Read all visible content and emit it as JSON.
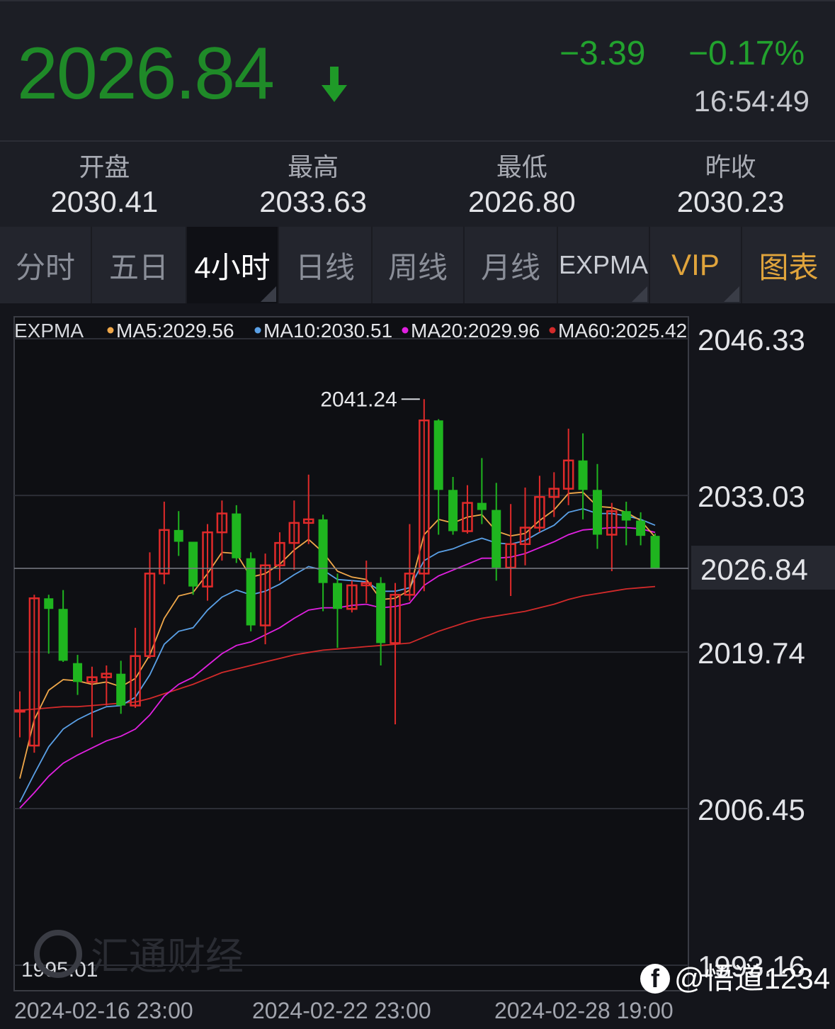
{
  "header": {
    "price": "2026.84",
    "arrow_icon": "arrow-down-icon",
    "change": "−3.39",
    "change_pct": "−0.17%",
    "time": "16:54:49"
  },
  "stats": [
    {
      "label": "开盘",
      "value": "2030.41"
    },
    {
      "label": "最高",
      "value": "2033.63"
    },
    {
      "label": "最低",
      "value": "2026.80"
    },
    {
      "label": "昨收",
      "value": "2030.23"
    }
  ],
  "tabs": [
    {
      "label": "分时"
    },
    {
      "label": "五日"
    },
    {
      "label": "4小时",
      "active": true
    },
    {
      "label": "日线"
    },
    {
      "label": "周线"
    },
    {
      "label": "月线"
    },
    {
      "label": "EXPMA"
    },
    {
      "label": "VIP"
    },
    {
      "label": "图表"
    }
  ],
  "colors": {
    "up": "#e02a2a",
    "down": "#1fb51f",
    "ma5": "#f0a84a",
    "ma10": "#5aa0e6",
    "ma20": "#e020e0",
    "ma60": "#d22a2a",
    "price": "#1f8a28"
  },
  "chart_data": {
    "type": "candlestick",
    "indicator": "EXPMA",
    "legend": [
      {
        "name": "MA5",
        "value": "2029.56",
        "color": "#f0a84a"
      },
      {
        "name": "MA10",
        "value": "2030.51",
        "color": "#5aa0e6"
      },
      {
        "name": "MA20",
        "value": "2029.96",
        "color": "#e020e0"
      },
      {
        "name": "MA60",
        "value": "2025.42",
        "color": "#d22a2a"
      }
    ],
    "y_ticks": [
      "2046.33",
      "2033.03",
      "2019.74",
      "2006.45",
      "1993.16"
    ],
    "ylim": [
      1993.16,
      2046.33
    ],
    "current_price": "2026.84",
    "max_label": "2041.24",
    "min_label": "1995.01",
    "x_labels": [
      "2024-02-16 23:00",
      "2024-02-22 23:00",
      "2024-02-28 19:00"
    ],
    "candles": [
      [
        2014.8,
        2014.8,
        2016.4,
        2012.5
      ],
      [
        2011.8,
        2024.3,
        2024.6,
        2011.2
      ],
      [
        2024.3,
        2023.4,
        2024.6,
        2019.6
      ],
      [
        2023.4,
        2019.0,
        2025.0,
        2018.9
      ],
      [
        2018.8,
        2017.2,
        2019.5,
        2016.1
      ],
      [
        2017.2,
        2017.6,
        2018.5,
        2012.5
      ],
      [
        2017.6,
        2017.9,
        2018.6,
        2015.2
      ],
      [
        2017.9,
        2015.2,
        2019.0,
        2014.5
      ],
      [
        2015.2,
        2019.4,
        2021.8,
        2015.0
      ],
      [
        2019.4,
        2026.4,
        2028.2,
        2019.2
      ],
      [
        2026.4,
        2030.1,
        2032.5,
        2025.5
      ],
      [
        2030.1,
        2029.1,
        2031.7,
        2027.9
      ],
      [
        2029.1,
        2025.3,
        2026.3,
        2024.6
      ],
      [
        2025.3,
        2029.9,
        2030.6,
        2024.1
      ],
      [
        2029.9,
        2031.5,
        2032.6,
        2027.5
      ],
      [
        2031.5,
        2027.7,
        2032.2,
        2027.3
      ],
      [
        2027.7,
        2022.0,
        2028.2,
        2021.5
      ],
      [
        2022.0,
        2027.1,
        2028.1,
        2020.4
      ],
      [
        2027.1,
        2029.0,
        2029.9,
        2025.8
      ],
      [
        2029.0,
        2030.7,
        2032.6,
        2026.7
      ],
      [
        2030.7,
        2031.0,
        2034.8,
        2028.9
      ],
      [
        2031.0,
        2025.6,
        2031.4,
        2023.2
      ],
      [
        2025.6,
        2023.4,
        2026.4,
        2020.1
      ],
      [
        2023.4,
        2025.4,
        2025.8,
        2023.1
      ],
      [
        2025.4,
        2025.6,
        2027.5,
        2023.9
      ],
      [
        2025.6,
        2020.5,
        2026.1,
        2018.6
      ],
      [
        2020.5,
        2024.6,
        2025.6,
        2013.6
      ],
      [
        2024.6,
        2026.4,
        2030.6,
        2024.1
      ],
      [
        2026.4,
        2039.4,
        2041.2,
        2024.9
      ],
      [
        2039.4,
        2033.5,
        2039.5,
        2029.7
      ],
      [
        2033.5,
        2030.0,
        2034.6,
        2029.7
      ],
      [
        2030.0,
        2032.4,
        2033.9,
        2029.8
      ],
      [
        2032.4,
        2031.8,
        2036.2,
        2030.6
      ],
      [
        2031.8,
        2026.9,
        2034.1,
        2025.8
      ],
      [
        2026.9,
        2028.9,
        2032.3,
        2024.5
      ],
      [
        2028.9,
        2030.3,
        2033.7,
        2027.1
      ],
      [
        2030.3,
        2032.9,
        2034.7,
        2029.9
      ],
      [
        2032.9,
        2033.6,
        2035.0,
        2031.2
      ],
      [
        2033.6,
        2036.0,
        2038.7,
        2032.2
      ],
      [
        2036.0,
        2033.5,
        2038.3,
        2031.0
      ],
      [
        2033.5,
        2029.7,
        2035.7,
        2028.5
      ],
      [
        2029.7,
        2031.7,
        2032.4,
        2026.6
      ],
      [
        2031.7,
        2030.9,
        2032.5,
        2028.8
      ],
      [
        2030.9,
        2029.6,
        2031.6,
        2028.8
      ],
      [
        2029.6,
        2026.8,
        2029.8,
        2026.8
      ]
    ],
    "ma5": [
      2009.0,
      2014.0,
      2016.5,
      2017.4,
      2017.3,
      2017.0,
      2017.2,
      2016.8,
      2017.5,
      2019.5,
      2022.6,
      2024.5,
      2024.8,
      2026.4,
      2028.2,
      2028.1,
      2026.1,
      2026.4,
      2027.2,
      2028.4,
      2029.3,
      2028.2,
      2026.6,
      2026.1,
      2025.9,
      2024.2,
      2024.3,
      2025.0,
      2029.7,
      2031.0,
      2030.7,
      2031.2,
      2031.4,
      2030.0,
      2029.6,
      2029.8,
      2030.9,
      2031.8,
      2033.2,
      2033.3,
      2032.1,
      2032.0,
      2031.6,
      2030.9,
      2029.5
    ],
    "ma10": [
      2007.0,
      2009.4,
      2011.7,
      2013.2,
      2014.0,
      2014.6,
      2015.1,
      2015.2,
      2015.9,
      2017.8,
      2020.4,
      2021.5,
      2021.8,
      2023.3,
      2024.4,
      2025.0,
      2024.6,
      2024.9,
      2025.5,
      2026.3,
      2027.0,
      2026.7,
      2025.9,
      2025.8,
      2025.7,
      2024.9,
      2024.9,
      2025.2,
      2027.5,
      2028.2,
      2028.5,
      2029.0,
      2029.4,
      2029.0,
      2028.9,
      2029.2,
      2029.9,
      2030.5,
      2031.6,
      2031.9,
      2031.5,
      2031.5,
      2031.3,
      2031.0,
      2030.5
    ],
    "ma20": [
      2006.5,
      2007.8,
      2009.2,
      2010.3,
      2011.0,
      2011.6,
      2012.2,
      2012.6,
      2013.2,
      2014.4,
      2016.0,
      2017.0,
      2017.6,
      2018.6,
      2019.6,
      2020.3,
      2020.6,
      2021.2,
      2021.8,
      2022.6,
      2023.3,
      2023.5,
      2023.5,
      2023.7,
      2023.8,
      2023.5,
      2023.6,
      2023.9,
      2025.4,
      2026.2,
      2026.7,
      2027.2,
      2027.7,
      2027.7,
      2027.8,
      2028.1,
      2028.6,
      2029.1,
      2029.7,
      2030.1,
      2030.2,
      2030.3,
      2030.3,
      2030.2,
      2029.9
    ],
    "ma60": [
      2014.8,
      2014.9,
      2015.0,
      2015.1,
      2015.1,
      2015.2,
      2015.3,
      2015.4,
      2015.5,
      2015.8,
      2016.2,
      2016.6,
      2017.0,
      2017.5,
      2018.0,
      2018.3,
      2018.6,
      2018.9,
      2019.2,
      2019.5,
      2019.7,
      2019.9,
      2020.0,
      2020.1,
      2020.2,
      2020.3,
      2020.4,
      2020.5,
      2021.0,
      2021.5,
      2021.9,
      2022.3,
      2022.6,
      2022.8,
      2023.0,
      2023.2,
      2023.5,
      2023.8,
      2024.2,
      2024.5,
      2024.7,
      2024.9,
      2025.1,
      2025.2,
      2025.3
    ]
  },
  "watermarks": {
    "brand": "汇通财经",
    "author": "@悟道1234",
    "fb_letter": "f"
  }
}
